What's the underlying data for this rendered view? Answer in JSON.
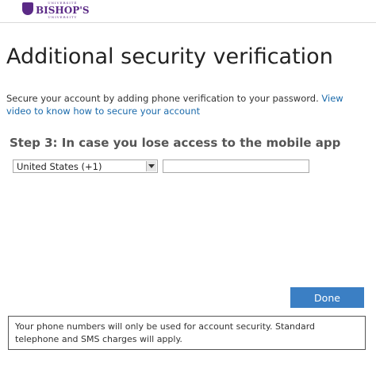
{
  "header": {
    "logo": {
      "top": "UNIVERSITÉ",
      "main": "BISHOP'S",
      "bottom": "UNIVERSITY"
    }
  },
  "page": {
    "title": "Additional security verification",
    "intro_text": "Secure your account by adding phone verification to your password.",
    "video_link": "View video to know how to secure your account"
  },
  "step": {
    "heading": "Step 3: In case you lose access to the mobile app"
  },
  "form": {
    "country_value": "United States (+1)",
    "phone_value": "",
    "phone_placeholder": ""
  },
  "actions": {
    "done_label": "Done"
  },
  "notice": {
    "text": "Your phone numbers will only be used for account security. Standard telephone and SMS charges will apply."
  },
  "colors": {
    "brand": "#5b2a86",
    "link": "#1a6aab",
    "primary_button": "#3b7fc4"
  }
}
